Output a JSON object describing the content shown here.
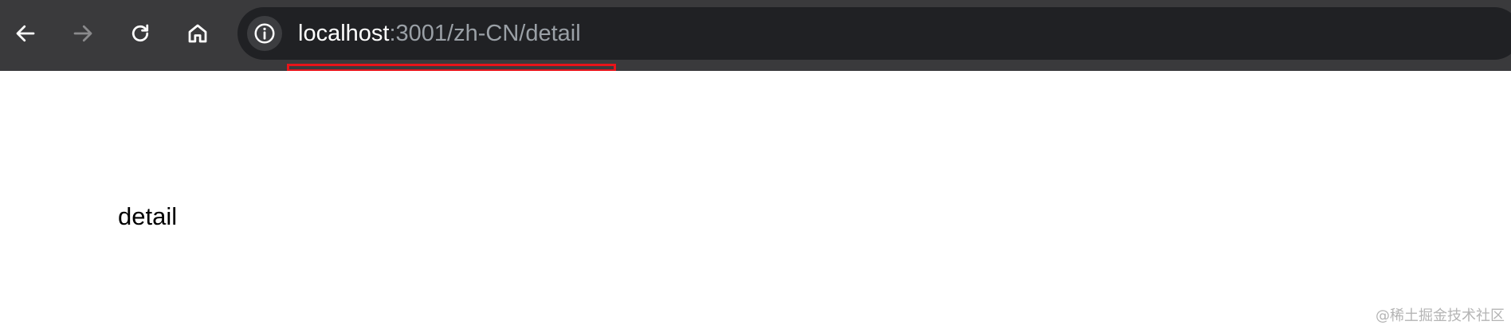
{
  "toolbar": {
    "back_icon": "arrow-left-icon",
    "forward_icon": "arrow-right-icon",
    "reload_icon": "reload-icon",
    "home_icon": "home-icon"
  },
  "address_bar": {
    "info_icon": "info-icon",
    "host": "localhost",
    "path": ":3001/zh-CN/detail"
  },
  "page": {
    "text": "detail"
  },
  "watermark": "@稀土掘金技术社区",
  "colors": {
    "toolbar_bg": "#3a3a3c",
    "omnibox_bg": "#202124",
    "highlight": "#e8141a"
  }
}
